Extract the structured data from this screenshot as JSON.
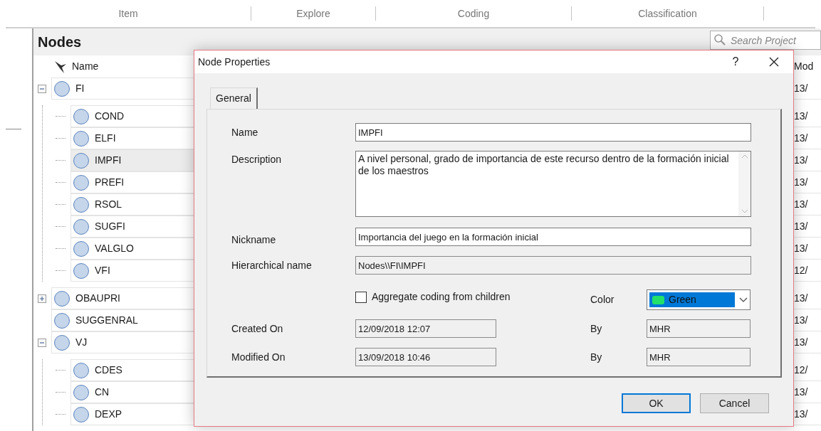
{
  "ribbon": {
    "groups": [
      "Item",
      "Explore",
      "Coding",
      "Classification"
    ]
  },
  "panel": {
    "title": "Nodes",
    "search": {
      "placeholder": "Search Project"
    }
  },
  "columns": {
    "name": "Name",
    "column_2": "Mod"
  },
  "nodes": [
    {
      "name": "FI",
      "column_2": "13/",
      "kind": "expanded",
      "selected": false,
      "children": [
        {
          "name": "COND",
          "column_2": "13/",
          "kind": "leaf",
          "selected": false
        },
        {
          "name": "ELFI",
          "column_2": "13/",
          "kind": "leaf",
          "selected": false
        },
        {
          "name": "IMPFI",
          "column_2": "13/",
          "kind": "leaf",
          "selected": true
        },
        {
          "name": "PREFI",
          "column_2": "13/",
          "kind": "leaf",
          "selected": false
        },
        {
          "name": "RSOL",
          "column_2": "13/",
          "kind": "leaf",
          "selected": false
        },
        {
          "name": "SUGFI",
          "column_2": "13/",
          "kind": "leaf",
          "selected": false
        },
        {
          "name": "VALGLO",
          "column_2": "13/",
          "kind": "leaf",
          "selected": false
        },
        {
          "name": "VFI",
          "column_2": "12/",
          "kind": "leaf",
          "selected": false
        }
      ]
    },
    {
      "name": "OBAUPRI",
      "column_2": "13/",
      "kind": "collapsed",
      "selected": false
    },
    {
      "name": "SUGGENRAL",
      "column_2": "13/",
      "kind": "leaf",
      "selected": false
    },
    {
      "name": "VJ",
      "column_2": "13/",
      "kind": "expanded",
      "selected": false,
      "children": [
        {
          "name": "CDES",
          "column_2": "12/",
          "kind": "leaf",
          "selected": false
        },
        {
          "name": "CN",
          "column_2": "13/",
          "kind": "leaf",
          "selected": false
        },
        {
          "name": "DEXP",
          "column_2": "13/",
          "kind": "leaf",
          "selected": false
        }
      ]
    }
  ],
  "dialog": {
    "title": "Node Properties",
    "help": "?",
    "tabs": [
      {
        "label": "General",
        "selected": true
      }
    ],
    "name": {
      "label": "Name",
      "value": "IMPFI"
    },
    "description": {
      "label": "Description",
      "value": "A nivel personal, grado de importancia de este recurso dentro de la formación inicial de los maestros"
    },
    "nickname": {
      "label": "Nickname",
      "value": "Importancia del juego en la formación inicial"
    },
    "hierarchical_name": {
      "label": "Hierarchical name",
      "value": "Nodes\\\\FI\\IMPFI"
    },
    "aggregate": {
      "label": "Aggregate coding from children",
      "checked": false
    },
    "color": {
      "label": "Color",
      "value": "Green",
      "color": "#22e06a"
    },
    "created": {
      "label": "Created On",
      "value": "12/09/2018 12:07",
      "by_label": "By",
      "by": "MHR"
    },
    "modified": {
      "label": "Modified On",
      "value": "13/09/2018 10:46",
      "by_label": "By",
      "by": "MHR"
    },
    "buttons": [
      {
        "label": "OK",
        "default": true
      },
      {
        "label": "Cancel",
        "default": false
      }
    ]
  }
}
